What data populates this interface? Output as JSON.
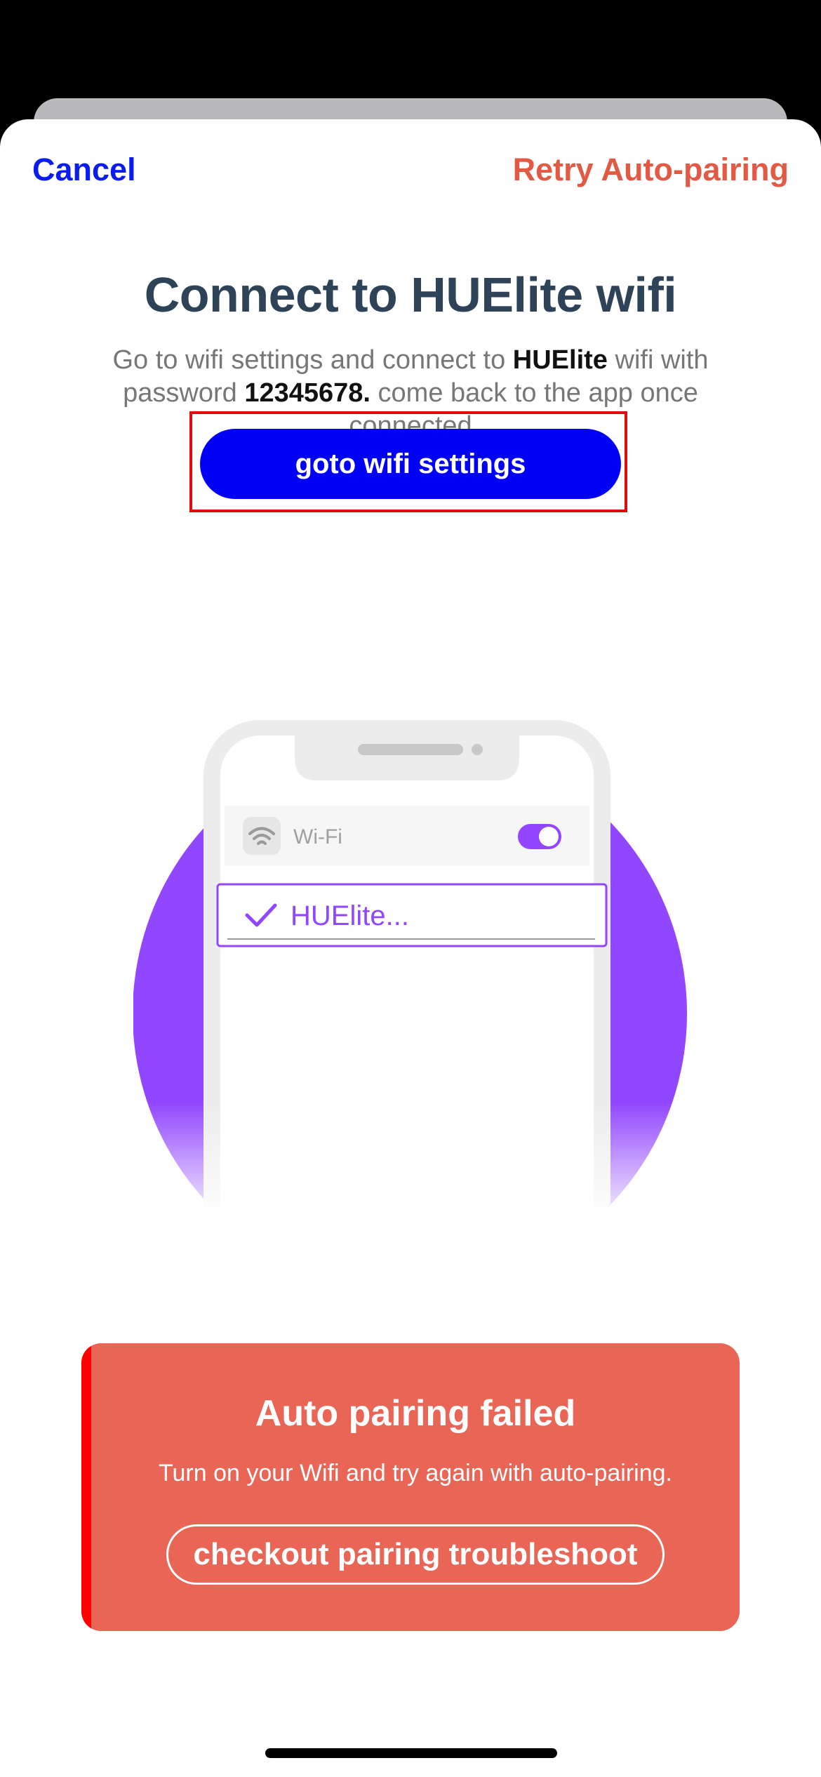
{
  "nav": {
    "cancel_label": "Cancel",
    "retry_label": "Retry Auto-pairing"
  },
  "main": {
    "title": "Connect to HUElite wifi",
    "desc_part1": "Go to wifi settings and connect to ",
    "desc_network": "HUElite",
    "desc_part2": " wifi with password ",
    "desc_password": "12345678.",
    "desc_part3": " come back to the app once connected",
    "button_label": "goto wifi settings"
  },
  "illustration": {
    "wifi_label": "Wi-Fi",
    "network_label": "HUElite...",
    "accent_color": "#9146ff"
  },
  "toast": {
    "title": "Auto pairing failed",
    "message": "Turn on your Wifi and try again with auto-pairing.",
    "button_label": "checkout pairing troubleshoot",
    "background_color": "#e96556"
  },
  "colors": {
    "link": "#0a1cf0",
    "retry": "#e25a43",
    "primary_button": "#0000f6",
    "title": "#2e4258"
  }
}
